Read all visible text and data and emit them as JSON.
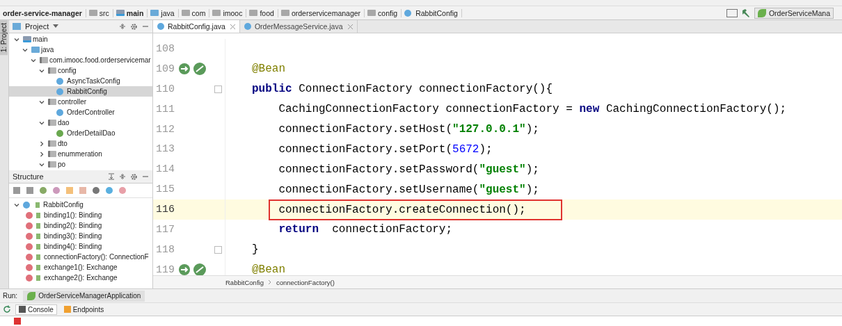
{
  "nav_bar": {
    "crumbs": [
      {
        "label": "order-service-manager",
        "kind": "project"
      },
      {
        "label": "src",
        "kind": "folder"
      },
      {
        "label": "main",
        "kind": "module"
      },
      {
        "label": "java",
        "kind": "source"
      },
      {
        "label": "com",
        "kind": "folder"
      },
      {
        "label": "imooc",
        "kind": "folder"
      },
      {
        "label": "food",
        "kind": "folder"
      },
      {
        "label": "orderservicemanager",
        "kind": "folder"
      },
      {
        "label": "config",
        "kind": "folder"
      },
      {
        "label": "RabbitConfig",
        "kind": "class"
      }
    ],
    "run_config": "OrderServiceMana"
  },
  "side_strip": {
    "label": "1: Project"
  },
  "project_panel": {
    "title": "Project",
    "tree": [
      {
        "label": "main",
        "kind": "module",
        "expanded": true,
        "selected": false,
        "children": [
          {
            "label": "java",
            "kind": "source",
            "expanded": true,
            "selected": false,
            "children": [
              {
                "label": "com.imooc.food.orderservicemar",
                "kind": "package",
                "expanded": true,
                "selected": false,
                "children": [
                  {
                    "label": "config",
                    "kind": "package",
                    "expanded": true,
                    "selected": false,
                    "children": [
                      {
                        "label": "AsyncTaskConfig",
                        "kind": "class",
                        "selected": false
                      },
                      {
                        "label": "RabbitConfig",
                        "kind": "class",
                        "selected": true
                      }
                    ]
                  },
                  {
                    "label": "controller",
                    "kind": "package",
                    "expanded": true,
                    "selected": false,
                    "children": [
                      {
                        "label": "OrderController",
                        "kind": "class",
                        "selected": false
                      }
                    ]
                  },
                  {
                    "label": "dao",
                    "kind": "package",
                    "expanded": true,
                    "selected": false,
                    "children": [
                      {
                        "label": "OrderDetailDao",
                        "kind": "interface",
                        "selected": false
                      }
                    ]
                  },
                  {
                    "label": "dto",
                    "kind": "package",
                    "expanded": false,
                    "selected": false
                  },
                  {
                    "label": "enummeration",
                    "kind": "package",
                    "expanded": false,
                    "selected": false
                  },
                  {
                    "label": "po",
                    "kind": "package",
                    "expanded": true,
                    "selected": false
                  }
                ]
              }
            ]
          }
        ]
      }
    ]
  },
  "structure_panel": {
    "title": "Structure",
    "root": {
      "label": "RabbitConfig",
      "expanded": true
    },
    "members": [
      "binding1(): Binding",
      "binding2(): Binding",
      "binding3(): Binding",
      "binding4(): Binding",
      "connectionFactory(): ConnectionF",
      "exchange1(): Exchange",
      "exchange2(): Exchange"
    ]
  },
  "editor": {
    "tabs": [
      {
        "label": "RabbitConfig.java",
        "selected": true
      },
      {
        "label": "OrderMessageService.java",
        "selected": false
      }
    ],
    "lines": [
      {
        "number": "108",
        "bean": false,
        "fold": false,
        "current": false
      },
      {
        "number": "109",
        "bean": true,
        "fold": false,
        "current": false,
        "boxed": false,
        "tokens": [
          {
            "kind": "annotation",
            "text": "@Bean"
          }
        ]
      },
      {
        "number": "110",
        "bean": false,
        "fold": true,
        "current": false,
        "boxed": false,
        "tokens": [
          {
            "kind": "keyword",
            "text": "public"
          },
          {
            "kind": "plain",
            "text": " ConnectionFactory connectionFactory(){"
          }
        ],
        "children": [
          {
            "number": "111",
            "bean": false,
            "fold": false,
            "current": false,
            "boxed": false,
            "tokens": [
              {
                "kind": "plain",
                "text": "CachingConnectionFactory connectionFactory = "
              },
              {
                "kind": "keyword",
                "text": "new"
              },
              {
                "kind": "plain",
                "text": " CachingConnectionFactory();"
              }
            ]
          },
          {
            "number": "112",
            "bean": false,
            "fold": false,
            "current": false,
            "boxed": false,
            "tokens": [
              {
                "kind": "plain",
                "text": "connectionFactory.setHost("
              },
              {
                "kind": "string",
                "text": "\"127.0.0.1\""
              },
              {
                "kind": "plain",
                "text": ");"
              }
            ]
          },
          {
            "number": "113",
            "bean": false,
            "fold": false,
            "current": false,
            "boxed": false,
            "tokens": [
              {
                "kind": "plain",
                "text": "connectionFactory.setPort("
              },
              {
                "kind": "number",
                "text": "5672"
              },
              {
                "kind": "plain",
                "text": ");"
              }
            ]
          },
          {
            "number": "114",
            "bean": false,
            "fold": false,
            "current": false,
            "boxed": false,
            "tokens": [
              {
                "kind": "plain",
                "text": "connectionFactory.setPassword("
              },
              {
                "kind": "string",
                "text": "\"guest\""
              },
              {
                "kind": "plain",
                "text": ");"
              }
            ]
          },
          {
            "number": "115",
            "bean": false,
            "fold": false,
            "current": false,
            "boxed": false,
            "tokens": [
              {
                "kind": "plain",
                "text": "connectionFactory.setUsername("
              },
              {
                "kind": "string",
                "text": "\"guest\""
              },
              {
                "kind": "plain",
                "text": ");"
              }
            ]
          },
          {
            "number": "116",
            "bean": false,
            "fold": false,
            "current": true,
            "boxed": true,
            "tokens": [
              {
                "kind": "plain",
                "text": "connectionFactory.createConnection();"
              }
            ]
          },
          {
            "number": "117",
            "bean": false,
            "fold": false,
            "current": false,
            "boxed": false,
            "tokens": [
              {
                "kind": "keyword",
                "text": "return"
              },
              {
                "kind": "plain",
                "text": "  connectionFactory;"
              }
            ]
          }
        ]
      },
      {
        "number": "118",
        "bean": false,
        "fold": true,
        "current": false,
        "boxed": false,
        "tokens": [
          {
            "kind": "plain",
            "text": "}"
          }
        ]
      },
      {
        "number": "119",
        "bean": true,
        "fold": false,
        "current": false,
        "boxed": false,
        "tokens": [
          {
            "kind": "annotation",
            "text": "@Bean"
          }
        ]
      }
    ],
    "breadcrumbs": [
      "RabbitConfig",
      "connectionFactory()"
    ]
  },
  "run_bar": {
    "label": "Run:",
    "config": "OrderServiceManagerApplication",
    "tabs": [
      {
        "label": "Console",
        "selected": true
      },
      {
        "label": "Endpoints",
        "selected": false
      }
    ]
  }
}
